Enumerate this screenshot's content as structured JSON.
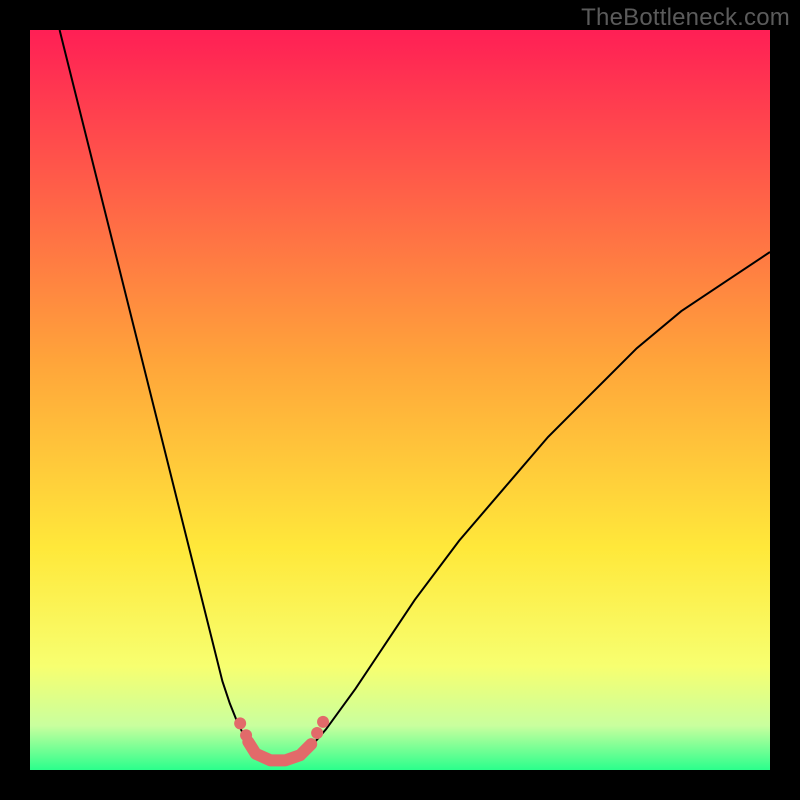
{
  "watermark": "TheBottleneck.com",
  "chart_data": {
    "type": "line",
    "title": "",
    "xlabel": "",
    "ylabel": "",
    "xlim": [
      0,
      100
    ],
    "ylim": [
      0,
      100
    ],
    "grid": false,
    "legend": false,
    "background_gradient": {
      "stops": [
        {
          "offset": 0.0,
          "color": "#ff1f55"
        },
        {
          "offset": 0.45,
          "color": "#ffa53a"
        },
        {
          "offset": 0.7,
          "color": "#ffe83a"
        },
        {
          "offset": 0.86,
          "color": "#f7ff70"
        },
        {
          "offset": 0.94,
          "color": "#c9ff9e"
        },
        {
          "offset": 1.0,
          "color": "#2bff8c"
        }
      ]
    },
    "series": [
      {
        "name": "left-branch",
        "color": "#000000",
        "width": 2,
        "x": [
          4,
          6,
          8,
          10,
          12,
          14,
          16,
          18,
          20,
          22,
          24,
          26,
          27,
          28,
          29,
          30,
          31,
          32
        ],
        "y": [
          100,
          92,
          84,
          76,
          68,
          60,
          52,
          44,
          36,
          28,
          20,
          12,
          9,
          6.5,
          4.5,
          3,
          2,
          1.5
        ]
      },
      {
        "name": "right-branch",
        "color": "#000000",
        "width": 2,
        "x": [
          36,
          37,
          38,
          40,
          44,
          48,
          52,
          58,
          64,
          70,
          76,
          82,
          88,
          94,
          100
        ],
        "y": [
          1.5,
          2.2,
          3.2,
          5.5,
          11,
          17,
          23,
          31,
          38,
          45,
          51,
          57,
          62,
          66,
          70
        ]
      },
      {
        "name": "valley-floor",
        "color": "#e26a6a",
        "width": 12,
        "linecap": "round",
        "x": [
          29.5,
          30.5,
          32.5,
          34.5,
          36.5,
          38.0
        ],
        "y": [
          3.8,
          2.2,
          1.3,
          1.3,
          2.0,
          3.5
        ]
      },
      {
        "name": "left-dots",
        "type": "scatter",
        "color": "#e26a6a",
        "size": 12,
        "x": [
          28.4,
          29.2
        ],
        "y": [
          6.3,
          4.7
        ]
      },
      {
        "name": "right-dots",
        "type": "scatter",
        "color": "#e26a6a",
        "size": 12,
        "x": [
          38.8,
          39.6
        ],
        "y": [
          5.0,
          6.5
        ]
      }
    ]
  }
}
